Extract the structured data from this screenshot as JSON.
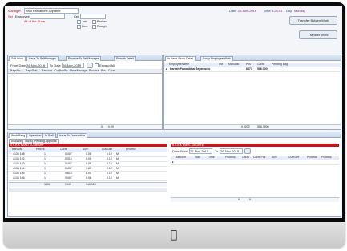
{
  "header": {
    "manager_label": "Manager",
    "manager_value": "Tinat Pamatikhe Aqnaner",
    "date_label": "Date :",
    "date_value": "25-Nov-2019",
    "time_label": "Time :",
    "time_value": "5:25:51",
    "day_label": "Day :",
    "day_value": "Monday",
    "sel_label": "Sel",
    "employee_label": "Employee",
    "cell_label": "Cell",
    "employee_note": "All of the Shee",
    "chk1": "Job",
    "chk2": "Line",
    "chk3": "Broken",
    "chk4": "Rough",
    "transfer_button": "Transfer Bulgen Work",
    "transfer_small_button": "Transfer Work"
  },
  "left_panel": {
    "tabs": [
      "Self Work",
      "Issue To SelfManager",
      "Receive To SelfManager",
      "Rework Detail"
    ],
    "from_label": "From Date",
    "from_value": "26-Nov-2019",
    "to_label": "To Date",
    "to_value": "26-Nov-2019",
    "expand_label": "Expand All",
    "columns": [
      "BagsNo",
      "BagsStat",
      "Barcode",
      "ConfirmBy",
      "PieceManager",
      "Process",
      "Pcs",
      "Carat"
    ],
    "footer_left": "0",
    "footer_right": "0.00"
  },
  "right_panel": {
    "tabs": [
      "In Hand Stock Detail",
      "Scrap Employee Work"
    ],
    "columns": [
      "EmployeeName",
      "Ctx",
      "Manuals",
      "Pcs",
      "Carat",
      "Pending Bag"
    ],
    "row_name": "Paresh Pamatibhai Jayarasnic",
    "row_pcs": "6873",
    "row_carat": "586.000",
    "footer_carat": "0,0072",
    "footer_total": "586.7900"
  },
  "bottom_panel": {
    "tabs": [
      "Work Bang",
      "Operation",
      "In Stall",
      "Issue To Transaction"
    ],
    "subtabs": [
      "Available",
      "Stuck",
      "Pending Approval"
    ],
    "left_banner": "STOCK HAND SUMMARY",
    "left_columns": [
      "Barcode",
      "Pieces",
      "Carat",
      "Size",
      "Cut/Size",
      "Process"
    ],
    "rows": [
      [
        "4136 108",
        "1",
        "0.407",
        "0.08",
        "0.12",
        "M"
      ],
      [
        "4136 102",
        "1",
        "0.315",
        "0.05",
        "0.12",
        "M"
      ],
      [
        "4136 103",
        "1",
        "0.407",
        "0.08",
        "0.12",
        "M"
      ],
      [
        "4136 104",
        "1",
        "0.407",
        "7.83",
        "0.12",
        "M"
      ],
      [
        "4136 105",
        "1",
        "0.815",
        "8.00",
        "0.12",
        "M"
      ],
      [
        "4136 106",
        "1",
        "0.407",
        "0.08",
        "0.12",
        "M"
      ]
    ],
    "left_footer": [
      "3451",
      "1943",
      "946.063"
    ],
    "right_banner": "STOCK EMPL. DEGREE",
    "right_from_label": "Date From",
    "right_from_value": "26-Nov-2019",
    "right_to_label": "To",
    "right_to_value": "26-Nov-2019",
    "right_columns": [
      "Barcode",
      "Stall",
      "Time",
      "Process",
      "Carat",
      "Carat Pcs",
      "Size",
      "Cut/Size",
      "Process",
      "Process"
    ],
    "right_footer": [
      "0",
      "0"
    ]
  },
  "colors": {
    "accent_red": "#c9141b",
    "accent_purple": "#8a1fa0",
    "bezel": "#0b0b0b"
  },
  "icons": {
    "monitor_logo": "apple-logo-icon"
  }
}
